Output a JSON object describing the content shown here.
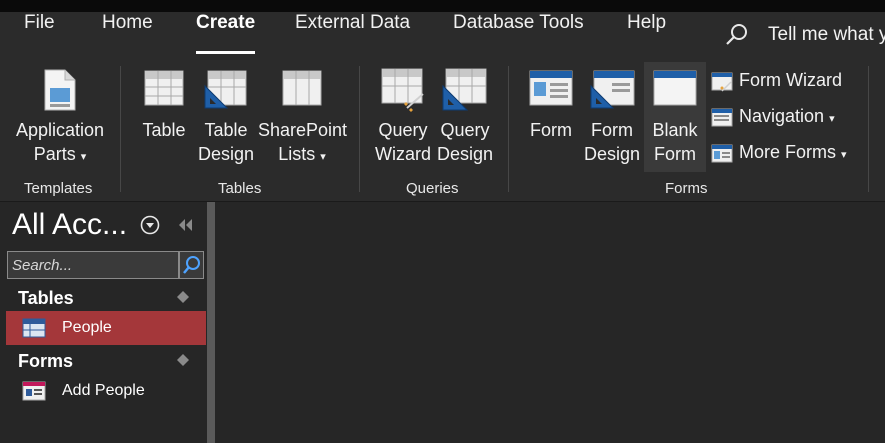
{
  "menu": {
    "tabs": [
      {
        "label": "File"
      },
      {
        "label": "Home"
      },
      {
        "label": "Create"
      },
      {
        "label": "External Data"
      },
      {
        "label": "Database Tools"
      },
      {
        "label": "Help"
      }
    ],
    "active_tab": "Create",
    "tell_me": "Tell me what y"
  },
  "ribbon": {
    "groups": {
      "templates": {
        "label": "Templates",
        "application_parts": {
          "line1": "Application",
          "line2": "Parts"
        }
      },
      "tables": {
        "label": "Tables",
        "table": {
          "line1": "Table"
        },
        "table_design": {
          "line1": "Table",
          "line2": "Design"
        },
        "sharepoint_lists": {
          "line1": "SharePoint",
          "line2": "Lists"
        }
      },
      "queries": {
        "label": "Queries",
        "query_wizard": {
          "line1": "Query",
          "line2": "Wizard"
        },
        "query_design": {
          "line1": "Query",
          "line2": "Design"
        }
      },
      "forms": {
        "label": "Forms",
        "form": {
          "line1": "Form"
        },
        "form_design": {
          "line1": "Form",
          "line2": "Design"
        },
        "blank_form": {
          "line1": "Blank",
          "line2": "Form"
        },
        "form_wizard": "Form Wizard",
        "navigation": "Navigation",
        "more_forms": "More Forms"
      }
    }
  },
  "nav_pane": {
    "title": "All Acc...",
    "search_placeholder": "Search...",
    "groups": [
      {
        "label": "Tables",
        "items": [
          {
            "label": "People",
            "selected": true
          }
        ]
      },
      {
        "label": "Forms",
        "items": [
          {
            "label": "Add People",
            "selected": false
          }
        ]
      }
    ]
  },
  "colors": {
    "accent": "#a4373a",
    "background": "#262626",
    "ribbon": "#2b2b2b"
  }
}
